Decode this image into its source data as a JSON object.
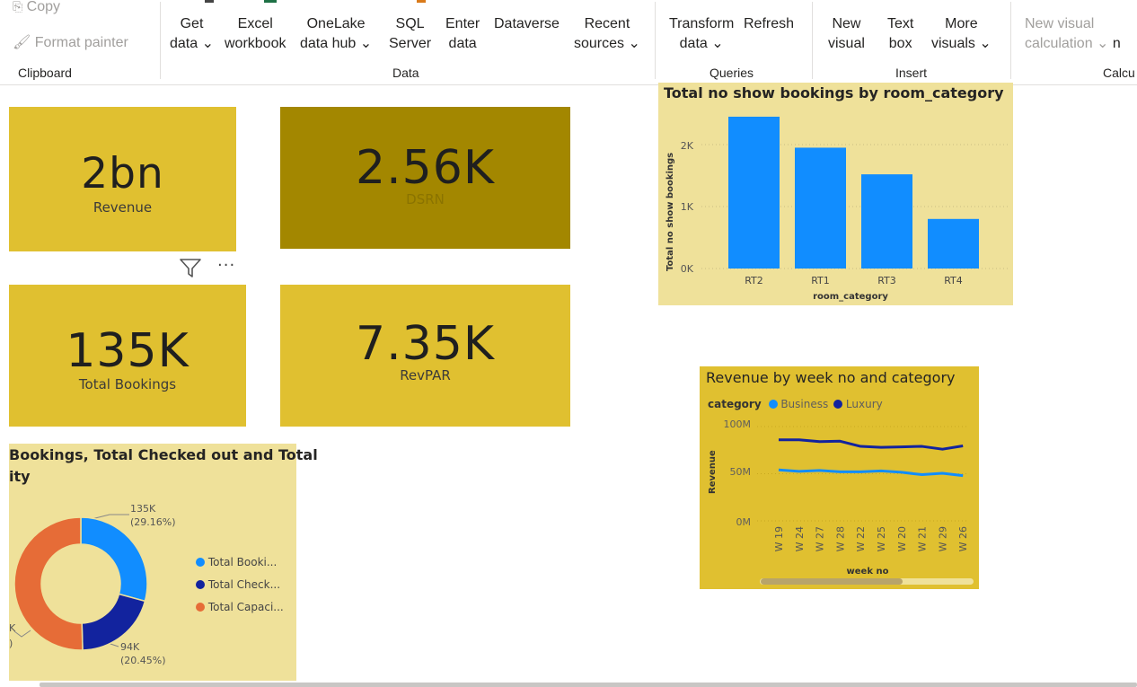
{
  "ribbon": {
    "clipboard": {
      "copy_label": "Copy",
      "format_painter_label": "Format painter",
      "group_label": "Clipboard"
    },
    "data": {
      "get_data": [
        "Get",
        "data ⌄"
      ],
      "excel": [
        "Excel",
        "workbook"
      ],
      "onelake": [
        "OneLake",
        "data hub ⌄"
      ],
      "sql": [
        "SQL",
        "Server"
      ],
      "enter": [
        "Enter",
        "data"
      ],
      "dataverse": "Dataverse",
      "recent": [
        "Recent",
        "sources ⌄"
      ],
      "group_label": "Data"
    },
    "queries": {
      "transform": [
        "Transform",
        "data ⌄"
      ],
      "refresh": "Refresh",
      "group_label": "Queries"
    },
    "insert": {
      "new_visual": [
        "New",
        "visual"
      ],
      "text_box": [
        "Text",
        "box"
      ],
      "more_visuals": [
        "More",
        "visuals ⌄"
      ],
      "group_label": "Insert"
    },
    "calc": {
      "new_visual_calc": [
        "New visual",
        "calculation ⌄"
      ],
      "extra": "n",
      "group_label": "Calcu"
    }
  },
  "cards": {
    "revenue": {
      "value": "2bn",
      "label": "Revenue"
    },
    "dsrn": {
      "value": "2.56K",
      "label": "DSRN"
    },
    "total_bookings": {
      "value": "135K",
      "label": "Total Bookings"
    },
    "revpar": {
      "value": "7.35K",
      "label": "RevPAR"
    }
  },
  "card_toolbar": {
    "filter_icon": "filter-icon",
    "more_icon": "more-options-icon",
    "more_glyph": "···"
  },
  "colors": {
    "card_gold": "#e0c030",
    "card_dark": "#a38700",
    "panel_light": "#efe19a",
    "panel_gold": "#e0c030",
    "bar_blue": "#118dff",
    "navy": "#12239e",
    "orange": "#e66c37"
  },
  "bar_chart": {
    "title": "Total no show bookings by room_category",
    "xlabel": "room_category",
    "ylabel": "Total no show bookings",
    "y_ticks": [
      "0K",
      "1K",
      "2K"
    ]
  },
  "line_chart": {
    "title": "Revenue by week no and category",
    "legend_title": "category",
    "xlabel": "week no",
    "ylabel": "Revenue",
    "y_ticks": [
      "0M",
      "50M",
      "100M"
    ]
  },
  "donut_chart": {
    "title_line1": "Bookings, Total Checked out and Total",
    "title_line2": "ity",
    "label_top": [
      "135K",
      "(29.16%)"
    ],
    "label_bottom": [
      "94K",
      "(20.45%)"
    ],
    "label_left": [
      "K",
      ")"
    ],
    "legend": [
      "Total Booki...",
      "Total Check...",
      "Total Capaci..."
    ]
  },
  "chart_data": [
    {
      "type": "bar",
      "title": "Total no show bookings by room_category",
      "xlabel": "room_category",
      "ylabel": "Total no show bookings",
      "categories": [
        "RT2",
        "RT1",
        "RT3",
        "RT4"
      ],
      "values": [
        2450,
        1950,
        1520,
        800
      ],
      "ylim": [
        0,
        2500
      ]
    },
    {
      "type": "line",
      "title": "Revenue by week no and category",
      "xlabel": "week no",
      "ylabel": "Revenue",
      "categories": [
        "W 19",
        "W 24",
        "W 27",
        "W 28",
        "W 22",
        "W 25",
        "W 20",
        "W 21",
        "W 29",
        "W 26"
      ],
      "series": [
        {
          "name": "Business",
          "values": [
            54000000,
            52500000,
            53500000,
            52000000,
            52000000,
            53000000,
            51500000,
            49000000,
            50500000,
            48000000
          ]
        },
        {
          "name": "Luxury",
          "values": [
            86000000,
            86000000,
            84000000,
            84500000,
            79000000,
            78000000,
            78500000,
            79000000,
            76000000,
            79500000
          ]
        }
      ],
      "ylim": [
        0,
        100000000
      ]
    },
    {
      "type": "pie",
      "labels": [
        "Total Booki...",
        "Total Check...",
        "Total Capaci..."
      ],
      "values": [
        135000,
        94000,
        233000
      ],
      "percents": [
        29.16,
        20.45,
        50.39
      ]
    }
  ]
}
